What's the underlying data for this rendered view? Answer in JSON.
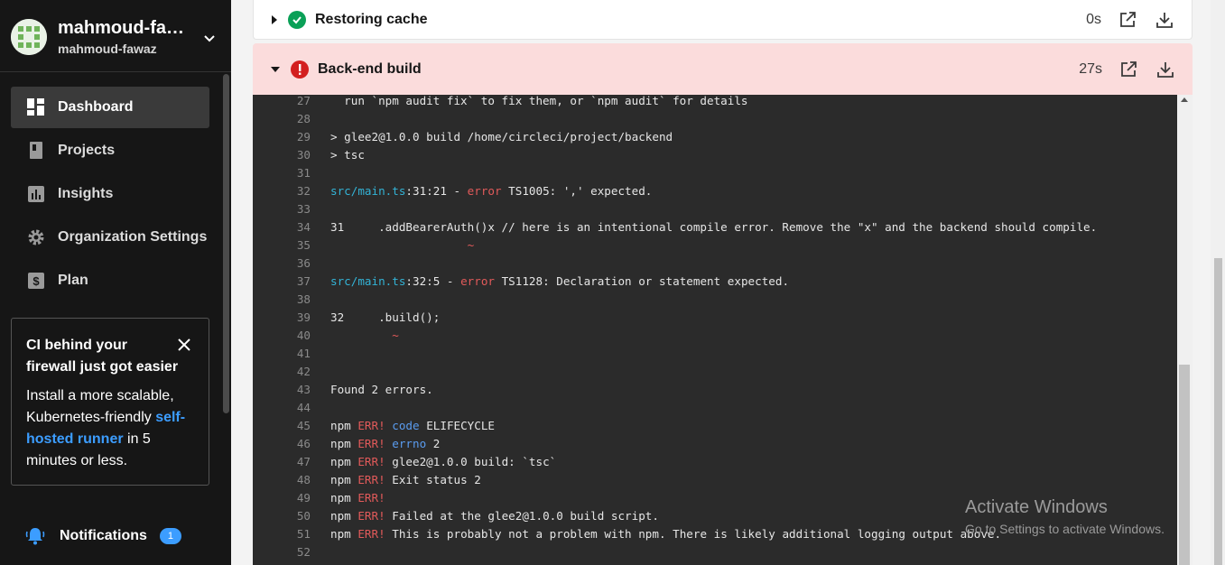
{
  "org": {
    "name": "mahmoud-faw...",
    "handle": "mahmoud-fawaz"
  },
  "nav": {
    "dashboard": "Dashboard",
    "projects": "Projects",
    "insights": "Insights",
    "org_settings": "Organization Settings",
    "plan": "Plan"
  },
  "promo": {
    "title": "CI behind your firewall just got easier",
    "body_before": "Install a more scalable, Kubernetes-friendly ",
    "link": "self-hosted runner",
    "body_after": " in 5 minutes or less."
  },
  "notifications": {
    "label": "Notifications",
    "count": "1"
  },
  "steps": {
    "restoring": {
      "name": "Restoring cache",
      "duration": "0s",
      "status": "success"
    },
    "backend": {
      "name": "Back-end build",
      "duration": "27s",
      "status": "failed"
    }
  },
  "log": {
    "lines": [
      {
        "n": "27",
        "t": "  run `npm audit fix` to fix them, or `npm audit` for details"
      },
      {
        "n": "28",
        "t": ""
      },
      {
        "n": "29",
        "t": "> glee2@1.0.0 build /home/circleci/project/backend"
      },
      {
        "n": "30",
        "t": "> tsc"
      },
      {
        "n": "31",
        "t": ""
      },
      {
        "n": "32",
        "file": "src/main.ts",
        "pos": ":31:21",
        "dash": " - ",
        "err": "error",
        "msg": " TS1005: ',' expected."
      },
      {
        "n": "33",
        "t": ""
      },
      {
        "n": "34",
        "t": "31     .addBearerAuth()x // here is an intentional compile error. Remove the \"x\" and the backend should compile."
      },
      {
        "n": "35",
        "tilde_pad": "                    ",
        "tilde": "~"
      },
      {
        "n": "36",
        "t": ""
      },
      {
        "n": "37",
        "file": "src/main.ts",
        "pos": ":32:5",
        "dash": " - ",
        "err": "error",
        "msg": " TS1128: Declaration or statement expected."
      },
      {
        "n": "38",
        "t": ""
      },
      {
        "n": "39",
        "t": "32     .build();"
      },
      {
        "n": "40",
        "tilde_pad": "         ",
        "tilde": "~"
      },
      {
        "n": "41",
        "t": ""
      },
      {
        "n": "42",
        "t": ""
      },
      {
        "n": "43",
        "t": "Found 2 errors."
      },
      {
        "n": "44",
        "t": ""
      },
      {
        "n": "45",
        "npm": "npm ",
        "ERR": "ERR!",
        "key": " code",
        "rest": " ELIFECYCLE"
      },
      {
        "n": "46",
        "npm": "npm ",
        "ERR": "ERR!",
        "key": " errno",
        "rest": " 2"
      },
      {
        "n": "47",
        "npm": "npm ",
        "ERR": "ERR!",
        "key": "",
        "rest": " glee2@1.0.0 build: `tsc`"
      },
      {
        "n": "48",
        "npm": "npm ",
        "ERR": "ERR!",
        "key": "",
        "rest": " Exit status 2"
      },
      {
        "n": "49",
        "npm": "npm ",
        "ERR": "ERR!",
        "key": "",
        "rest": ""
      },
      {
        "n": "50",
        "npm": "npm ",
        "ERR": "ERR!",
        "key": "",
        "rest": " Failed at the glee2@1.0.0 build script."
      },
      {
        "n": "51",
        "npm": "npm ",
        "ERR": "ERR!",
        "key": "",
        "rest": " This is probably not a problem with npm. There is likely additional logging output above."
      },
      {
        "n": "52",
        "t": ""
      }
    ]
  },
  "watermark": {
    "line1": "Activate Windows",
    "line2": "Go to Settings to activate Windows."
  },
  "colors": {
    "sidebar": "#161616",
    "link": "#3c9dff",
    "error_bg": "#fbdcdc",
    "success": "#0aa057",
    "failed": "#d31f1f"
  }
}
